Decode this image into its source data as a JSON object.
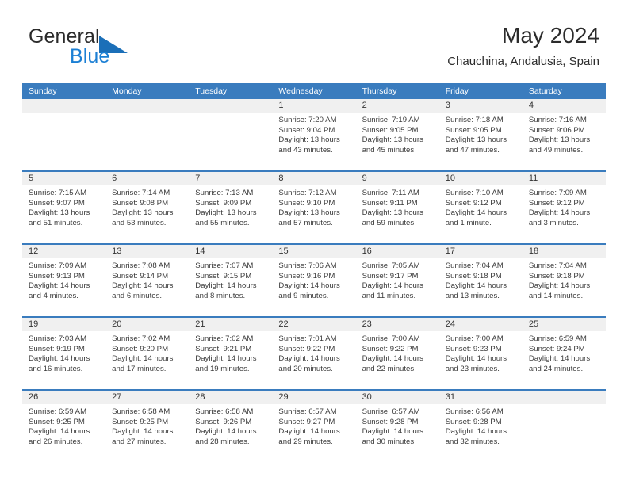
{
  "brand": {
    "name_part1": "General",
    "name_part2": "Blue",
    "flag_icon": "triangle-flag-icon"
  },
  "header": {
    "title": "May 2024",
    "subtitle": "Chauchina, Andalusia, Spain"
  },
  "colors": {
    "header_blue": "#3a7cbe",
    "brand_blue": "#1b7fd4",
    "daynum_band": "#f0f0f0",
    "text": "#3b3b3b"
  },
  "calendar": {
    "weekdays": [
      "Sunday",
      "Monday",
      "Tuesday",
      "Wednesday",
      "Thursday",
      "Friday",
      "Saturday"
    ],
    "weeks": [
      [
        {
          "day": "",
          "lines": [
            "",
            "",
            "",
            ""
          ]
        },
        {
          "day": "",
          "lines": [
            "",
            "",
            "",
            ""
          ]
        },
        {
          "day": "",
          "lines": [
            "",
            "",
            "",
            ""
          ]
        },
        {
          "day": "1",
          "lines": [
            "Sunrise: 7:20 AM",
            "Sunset: 9:04 PM",
            "Daylight: 13 hours",
            "and 43 minutes."
          ]
        },
        {
          "day": "2",
          "lines": [
            "Sunrise: 7:19 AM",
            "Sunset: 9:05 PM",
            "Daylight: 13 hours",
            "and 45 minutes."
          ]
        },
        {
          "day": "3",
          "lines": [
            "Sunrise: 7:18 AM",
            "Sunset: 9:05 PM",
            "Daylight: 13 hours",
            "and 47 minutes."
          ]
        },
        {
          "day": "4",
          "lines": [
            "Sunrise: 7:16 AM",
            "Sunset: 9:06 PM",
            "Daylight: 13 hours",
            "and 49 minutes."
          ]
        }
      ],
      [
        {
          "day": "5",
          "lines": [
            "Sunrise: 7:15 AM",
            "Sunset: 9:07 PM",
            "Daylight: 13 hours",
            "and 51 minutes."
          ]
        },
        {
          "day": "6",
          "lines": [
            "Sunrise: 7:14 AM",
            "Sunset: 9:08 PM",
            "Daylight: 13 hours",
            "and 53 minutes."
          ]
        },
        {
          "day": "7",
          "lines": [
            "Sunrise: 7:13 AM",
            "Sunset: 9:09 PM",
            "Daylight: 13 hours",
            "and 55 minutes."
          ]
        },
        {
          "day": "8",
          "lines": [
            "Sunrise: 7:12 AM",
            "Sunset: 9:10 PM",
            "Daylight: 13 hours",
            "and 57 minutes."
          ]
        },
        {
          "day": "9",
          "lines": [
            "Sunrise: 7:11 AM",
            "Sunset: 9:11 PM",
            "Daylight: 13 hours",
            "and 59 minutes."
          ]
        },
        {
          "day": "10",
          "lines": [
            "Sunrise: 7:10 AM",
            "Sunset: 9:12 PM",
            "Daylight: 14 hours",
            "and 1 minute."
          ]
        },
        {
          "day": "11",
          "lines": [
            "Sunrise: 7:09 AM",
            "Sunset: 9:12 PM",
            "Daylight: 14 hours",
            "and 3 minutes."
          ]
        }
      ],
      [
        {
          "day": "12",
          "lines": [
            "Sunrise: 7:09 AM",
            "Sunset: 9:13 PM",
            "Daylight: 14 hours",
            "and 4 minutes."
          ]
        },
        {
          "day": "13",
          "lines": [
            "Sunrise: 7:08 AM",
            "Sunset: 9:14 PM",
            "Daylight: 14 hours",
            "and 6 minutes."
          ]
        },
        {
          "day": "14",
          "lines": [
            "Sunrise: 7:07 AM",
            "Sunset: 9:15 PM",
            "Daylight: 14 hours",
            "and 8 minutes."
          ]
        },
        {
          "day": "15",
          "lines": [
            "Sunrise: 7:06 AM",
            "Sunset: 9:16 PM",
            "Daylight: 14 hours",
            "and 9 minutes."
          ]
        },
        {
          "day": "16",
          "lines": [
            "Sunrise: 7:05 AM",
            "Sunset: 9:17 PM",
            "Daylight: 14 hours",
            "and 11 minutes."
          ]
        },
        {
          "day": "17",
          "lines": [
            "Sunrise: 7:04 AM",
            "Sunset: 9:18 PM",
            "Daylight: 14 hours",
            "and 13 minutes."
          ]
        },
        {
          "day": "18",
          "lines": [
            "Sunrise: 7:04 AM",
            "Sunset: 9:18 PM",
            "Daylight: 14 hours",
            "and 14 minutes."
          ]
        }
      ],
      [
        {
          "day": "19",
          "lines": [
            "Sunrise: 7:03 AM",
            "Sunset: 9:19 PM",
            "Daylight: 14 hours",
            "and 16 minutes."
          ]
        },
        {
          "day": "20",
          "lines": [
            "Sunrise: 7:02 AM",
            "Sunset: 9:20 PM",
            "Daylight: 14 hours",
            "and 17 minutes."
          ]
        },
        {
          "day": "21",
          "lines": [
            "Sunrise: 7:02 AM",
            "Sunset: 9:21 PM",
            "Daylight: 14 hours",
            "and 19 minutes."
          ]
        },
        {
          "day": "22",
          "lines": [
            "Sunrise: 7:01 AM",
            "Sunset: 9:22 PM",
            "Daylight: 14 hours",
            "and 20 minutes."
          ]
        },
        {
          "day": "23",
          "lines": [
            "Sunrise: 7:00 AM",
            "Sunset: 9:22 PM",
            "Daylight: 14 hours",
            "and 22 minutes."
          ]
        },
        {
          "day": "24",
          "lines": [
            "Sunrise: 7:00 AM",
            "Sunset: 9:23 PM",
            "Daylight: 14 hours",
            "and 23 minutes."
          ]
        },
        {
          "day": "25",
          "lines": [
            "Sunrise: 6:59 AM",
            "Sunset: 9:24 PM",
            "Daylight: 14 hours",
            "and 24 minutes."
          ]
        }
      ],
      [
        {
          "day": "26",
          "lines": [
            "Sunrise: 6:59 AM",
            "Sunset: 9:25 PM",
            "Daylight: 14 hours",
            "and 26 minutes."
          ]
        },
        {
          "day": "27",
          "lines": [
            "Sunrise: 6:58 AM",
            "Sunset: 9:25 PM",
            "Daylight: 14 hours",
            "and 27 minutes."
          ]
        },
        {
          "day": "28",
          "lines": [
            "Sunrise: 6:58 AM",
            "Sunset: 9:26 PM",
            "Daylight: 14 hours",
            "and 28 minutes."
          ]
        },
        {
          "day": "29",
          "lines": [
            "Sunrise: 6:57 AM",
            "Sunset: 9:27 PM",
            "Daylight: 14 hours",
            "and 29 minutes."
          ]
        },
        {
          "day": "30",
          "lines": [
            "Sunrise: 6:57 AM",
            "Sunset: 9:28 PM",
            "Daylight: 14 hours",
            "and 30 minutes."
          ]
        },
        {
          "day": "31",
          "lines": [
            "Sunrise: 6:56 AM",
            "Sunset: 9:28 PM",
            "Daylight: 14 hours",
            "and 32 minutes."
          ]
        },
        {
          "day": "",
          "lines": [
            "",
            "",
            "",
            ""
          ]
        }
      ]
    ]
  }
}
